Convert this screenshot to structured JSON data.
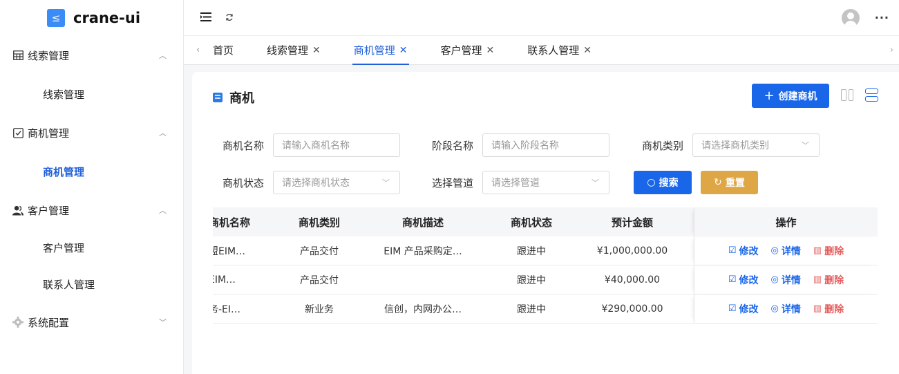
{
  "app": {
    "logo_icon": "logo-icon",
    "name": "crane-ui",
    "accent": "#1a66e8"
  },
  "sidebar": {
    "groups": [
      {
        "label": "线索管理",
        "icon": "table-icon",
        "expanded": true,
        "items": [
          "线索管理"
        ]
      },
      {
        "label": "商机管理",
        "icon": "checkbox-icon",
        "expanded": true,
        "items": [
          "商机管理"
        ]
      },
      {
        "label": "客户管理",
        "icon": "user-icon",
        "expanded": true,
        "items": [
          "客户管理",
          "联系人管理"
        ]
      },
      {
        "label": "系统配置",
        "icon": "gear-icon",
        "expanded": false,
        "items": []
      }
    ],
    "active_item": "商机管理"
  },
  "tabs": [
    {
      "label": "首页",
      "closable": false
    },
    {
      "label": "线索管理",
      "closable": true
    },
    {
      "label": "商机管理",
      "closable": true,
      "active": true
    },
    {
      "label": "客户管理",
      "closable": true
    },
    {
      "label": "联系人管理",
      "closable": true
    }
  ],
  "page": {
    "title": "商机",
    "create_button": "创建商机"
  },
  "filters": {
    "name_label": "商机名称",
    "name_placeholder": "请输入商机名称",
    "stage_label": "阶段名称",
    "stage_placeholder": "请输入阶段名称",
    "category_label": "商机类别",
    "category_placeholder": "请选择商机类别",
    "status_label": "商机状态",
    "status_placeholder": "请选择商机状态",
    "pipeline_label": "选择管道",
    "pipeline_placeholder": "请选择管道",
    "search_button": "搜索",
    "reset_button": "重置"
  },
  "table": {
    "columns": [
      "商机名称",
      "商机类别",
      "商机描述",
      "商机状态",
      "预计金额",
      "操作"
    ],
    "rows": [
      {
        "name": "盟EIM…",
        "category": "产品交付",
        "desc": "EIM 产品采购定…",
        "status": "跟进中",
        "amount": "¥1,000,000.00"
      },
      {
        "name": "EIM…",
        "category": "产品交付",
        "desc": "",
        "status": "跟进中",
        "amount": "¥40,000.00"
      },
      {
        "name": "务-EI…",
        "category": "新业务",
        "desc": "信创，内网办公…",
        "status": "跟进中",
        "amount": "¥290,000.00"
      }
    ],
    "actions": {
      "edit": "修改",
      "view": "详情",
      "delete": "删除"
    }
  }
}
